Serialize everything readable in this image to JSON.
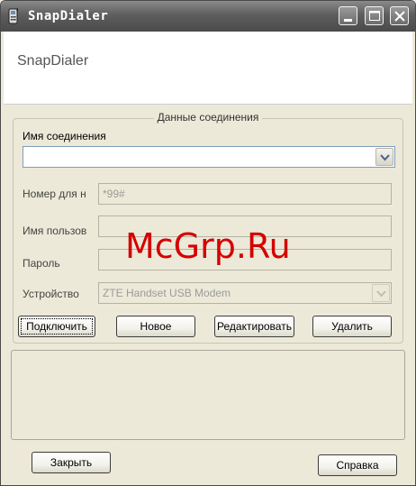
{
  "window": {
    "title": "SnapDialer",
    "controls": [
      "minimize",
      "maximize",
      "close"
    ]
  },
  "header": {
    "title": "SnapDialer"
  },
  "connection_group": {
    "legend": "Данные соединения",
    "connection_name_label": "Имя соединения",
    "connection_name_value": "",
    "phone_label": "Номер для н",
    "phone_value": "*99#",
    "username_label": "Имя пользов",
    "username_value": "",
    "password_label": "Пароль",
    "password_value": "",
    "device_label": "Устройство",
    "device_value": "ZTE Handset USB Modem"
  },
  "buttons": {
    "connect": "Подключить",
    "new": "Новое",
    "edit": "Редактировать",
    "delete": "Удалить",
    "close": "Закрыть",
    "help": "Справка"
  },
  "watermark": "McGrp.Ru"
}
